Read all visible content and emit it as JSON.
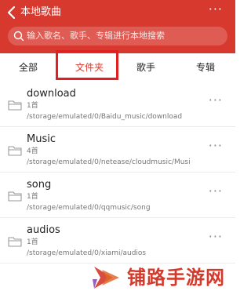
{
  "header": {
    "title": "本地歌曲",
    "more_label": "···",
    "search_placeholder": "输入歌名、歌手、专辑进行本地搜索"
  },
  "tabs": [
    {
      "label": "全部",
      "selected": false
    },
    {
      "label": "文件夹",
      "selected": true
    },
    {
      "label": "歌手",
      "selected": false
    },
    {
      "label": "专辑",
      "selected": false
    }
  ],
  "folders": [
    {
      "name": "download",
      "count": "1首",
      "path": "/storage/emulated/0/Baidu_music/download"
    },
    {
      "name": "Music",
      "count": "4首",
      "path": "/storage/emulated/0/netease/cloudmusic/Musi"
    },
    {
      "name": "song",
      "count": "1首",
      "path": "/storage/emulated/0/qqmusic/song"
    },
    {
      "name": "audios",
      "count": "1首",
      "path": "/storage/emulated/0/xiami/audios"
    }
  ],
  "row_more_label": "···",
  "watermark": {
    "text": "铺路手游网"
  },
  "colors": {
    "accent": "#d8392f",
    "highlight": "#e02020",
    "watermark": "#d43a2c"
  }
}
